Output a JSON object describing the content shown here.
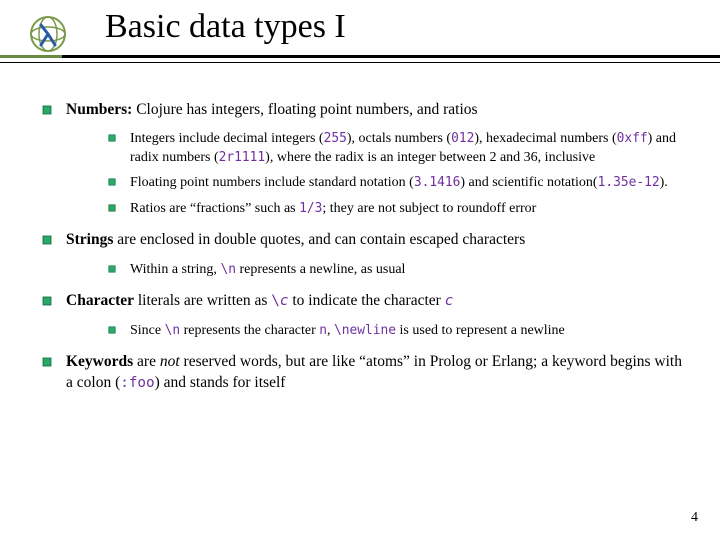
{
  "title": "Basic data types I",
  "page_number": "4",
  "items": [
    {
      "lead_bold": "Numbers:",
      "rest": " Clojure has integers, floating point numbers, and ratios",
      "sub": [
        {
          "html": "Integers include decimal integers (<span class='code purple'>255</span>), octals numbers (<span class='code purple'>012</span>), hexadecimal numbers (<span class='code purple'>0xff</span>) and radix numbers (<span class='code purple'>2r1111</span>), where the radix is an integer between 2 and 36, inclusive"
        },
        {
          "html": "Floating point numbers include standard notation (<span class='code purple'>3.1416</span>) and scientific notation(<span class='code purple'>1.35e-12</span>)."
        },
        {
          "html": "Ratios are “fractions” such as <span class='code purple'>1/3</span>; they are not subject to roundoff error"
        }
      ]
    },
    {
      "lead_bold": "Strings",
      "rest": " are enclosed in double quotes, and can contain escaped characters",
      "sub": [
        {
          "html": "Within a string, <span class='code purple'>\\n</span> represents a newline, as usual"
        }
      ]
    },
    {
      "lead_bold": "Character",
      "rest_html": " literals are written as <span class='code purple'>\\</span><span class='code purple i'>c</span> to indicate the character <span class='code purple i'>c</span>",
      "sub": [
        {
          "html": "Since <span class='code purple'>\\n</span> represents the character <span class='code purple'>n</span>, <span class='code purple'>\\newline</span> is used to represent a newline"
        }
      ]
    },
    {
      "lead_bold": "Keywords",
      "rest_html": " are <span class='i'>not</span> reserved words, but are like “atoms” in Prolog or Erlang; a keyword begins with a colon (<span class='code purple'>:foo</span>) and stands for itself",
      "sub": []
    }
  ]
}
